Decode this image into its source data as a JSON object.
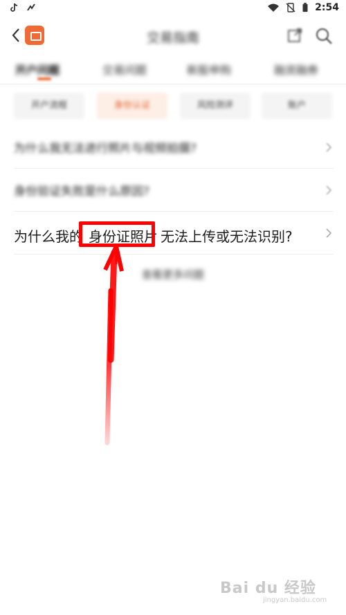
{
  "status_bar": {
    "time": "2:54",
    "icons": [
      "tiktok-icon",
      "gesture-icon",
      "wifi-icon",
      "no-sim-icon",
      "battery-icon"
    ]
  },
  "nav": {
    "title": "交易指南",
    "icons": [
      "back-icon",
      "app-logo",
      "share-icon",
      "search-icon"
    ]
  },
  "tabs": [
    {
      "label": "开户问题",
      "active": true
    },
    {
      "label": "交易问题",
      "active": false
    },
    {
      "label": "新股申购",
      "active": false
    },
    {
      "label": "融资融券",
      "active": false
    }
  ],
  "chips": [
    {
      "label": "开户流程",
      "active": false
    },
    {
      "label": "身份认证",
      "active": true
    },
    {
      "label": "风险测评",
      "active": false
    },
    {
      "label": "账户",
      "active": false
    }
  ],
  "questions": [
    {
      "text": "为什么我无法进行照片与视频拍摄?"
    },
    {
      "text": "身份验证失败是什么原因?"
    },
    {
      "before": "为什么我的",
      "highlight": "身份证照片",
      "after": "无法上传或无法识别?"
    }
  ],
  "more_link": "查看更多问题",
  "annotation": {
    "color": "#ff0000"
  },
  "watermark": {
    "brand": "Bai du 经验",
    "url": "jingyan.baidu.com"
  }
}
